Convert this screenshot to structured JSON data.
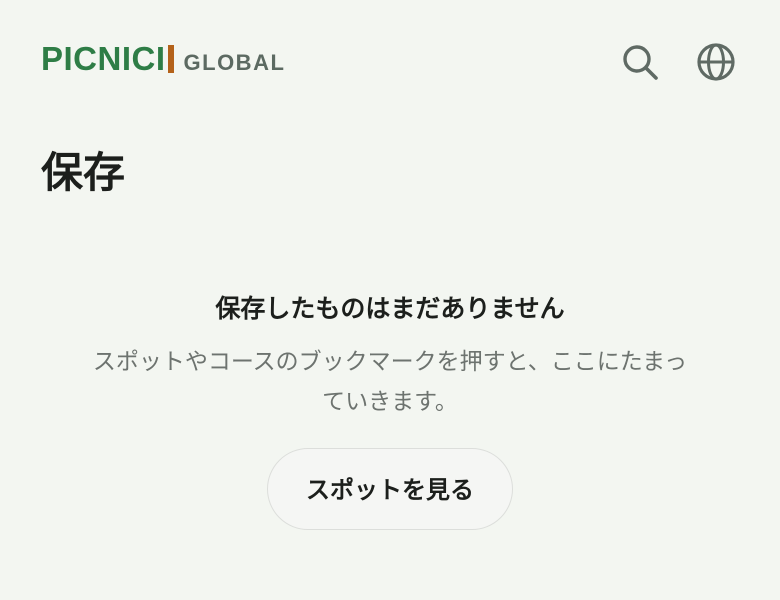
{
  "header": {
    "logo_main": "PICNICI",
    "logo_sub": "GLOBAL",
    "search_icon": "search-icon",
    "globe_icon": "globe-icon"
  },
  "page": {
    "title": "保存"
  },
  "empty_state": {
    "title": "保存したものはまだありません",
    "description": "スポットやコースのブックマークを押すと、ここにたまっていきます。",
    "button_label": "スポットを見る"
  },
  "colors": {
    "background": "#f3f6f1",
    "brand_green": "#2e7d46",
    "brand_accent": "#b4621a",
    "logo_sub": "#5c6a62",
    "icon": "#5f6a64",
    "text_primary": "#1c1f1c",
    "text_secondary": "#6d736f"
  }
}
